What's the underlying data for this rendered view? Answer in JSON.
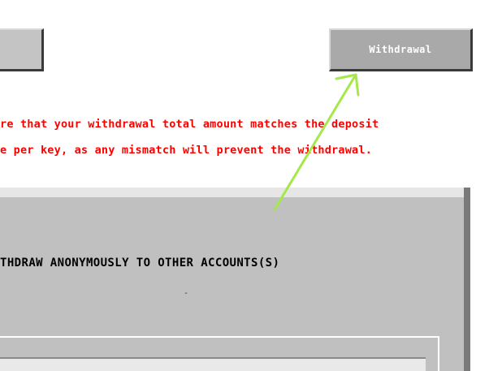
{
  "toolbar": {
    "left_button_label": "",
    "withdrawal_label": "Withdrawal"
  },
  "notice": {
    "line1": "re that your withdrawal total amount matches the deposit",
    "line2": "e per key, as any mismatch will prevent the withdrawal.",
    "color": "#ff0000"
  },
  "panel": {
    "heading": "THDRAW ANONYMOUSLY TO OTHER ACCOUNTS(S)",
    "mark": "-"
  },
  "annotation": {
    "arrow_color": "#a4e84a",
    "icon": "annotation-arrow-icon"
  }
}
